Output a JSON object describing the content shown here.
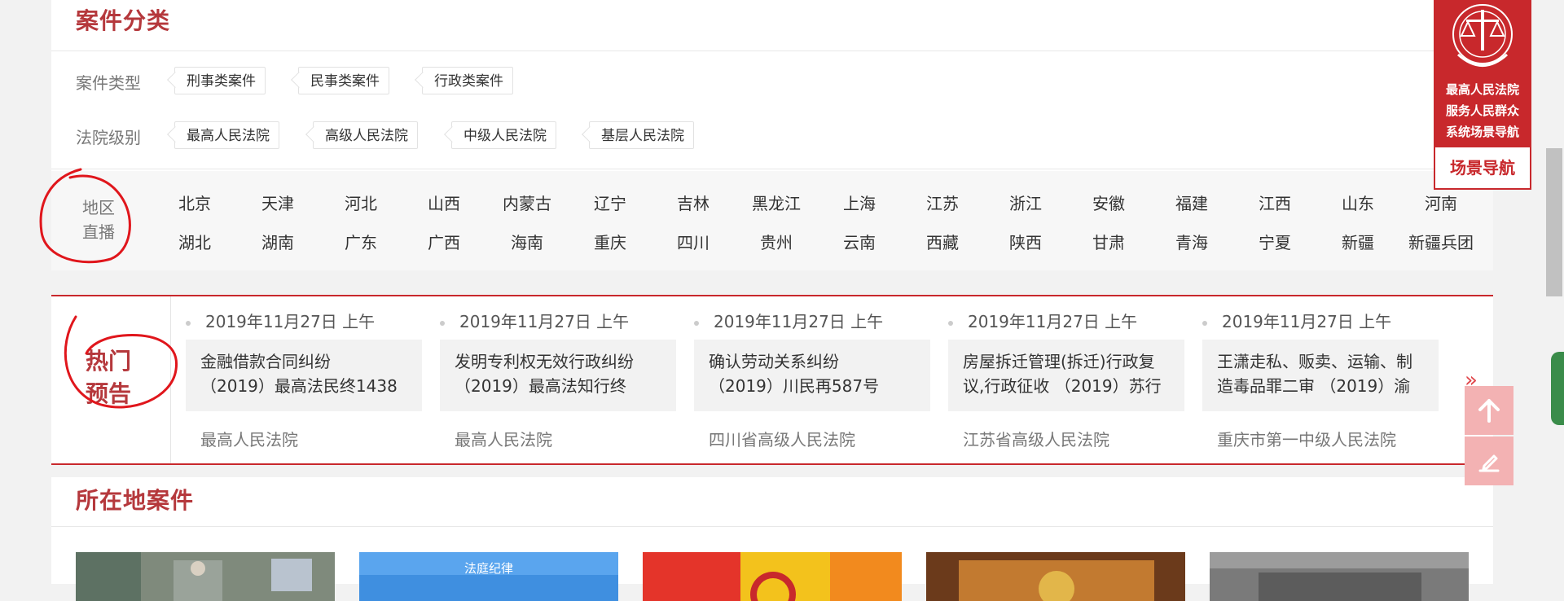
{
  "case_category": {
    "title": "案件分类",
    "case_type_label": "案件类型",
    "case_types": [
      "刑事类案件",
      "民事类案件",
      "行政类案件"
    ],
    "court_level_label": "法院级别",
    "court_levels": [
      "最高人民法院",
      "高级人民法院",
      "中级人民法院",
      "基层人民法院"
    ],
    "region_label_line1": "地区",
    "region_label_line2": "直播",
    "regions_row1": [
      "北京",
      "天津",
      "河北",
      "山西",
      "内蒙古",
      "辽宁",
      "吉林",
      "黑龙江",
      "上海",
      "江苏",
      "浙江",
      "安徽",
      "福建",
      "江西",
      "山东",
      "河南"
    ],
    "regions_row2": [
      "湖北",
      "湖南",
      "广东",
      "广西",
      "海南",
      "重庆",
      "四川",
      "贵州",
      "云南",
      "西藏",
      "陕西",
      "甘肃",
      "青海",
      "宁夏",
      "新疆",
      "新疆兵团"
    ]
  },
  "hot_preview": {
    "label_line1": "热门",
    "label_line2": "预告",
    "next_arrow": "»",
    "cards": [
      {
        "time": "2019年11月27日 上午",
        "line1": "金融借款合同纠纷",
        "line2": "（2019）最高法民终1438",
        "court": "最高人民法院"
      },
      {
        "time": "2019年11月27日 上午",
        "line1": "发明专利权无效行政纠纷",
        "line2": "（2019）最高法知行终",
        "court": "最高人民法院"
      },
      {
        "time": "2019年11月27日 上午",
        "line1": "确认劳动关系纠纷",
        "line2": "（2019）川民再587号",
        "court": "四川省高级人民法院"
      },
      {
        "time": "2019年11月27日 上午",
        "line1": "房屋拆迁管理(拆迁)行政复",
        "line2": "议,行政征收 （2019）苏行",
        "court": "江苏省高级人民法院"
      },
      {
        "time": "2019年11月27日 上午",
        "line1": "王潇走私、贩卖、运输、制",
        "line2": "造毒品罪二审 （2019）渝",
        "court": "重庆市第一中级人民法院"
      }
    ]
  },
  "location_cases": {
    "title": "所在地案件",
    "thumb2_caption": "法庭纪律"
  },
  "scene_nav": {
    "line1": "最高人民法院",
    "line2": "服务人民群众",
    "line3": "系统场景导航",
    "button": "场景导航"
  },
  "icons": {
    "top": "arrow-up-icon",
    "edit": "edit-icon",
    "emblem": "court-emblem-icon"
  },
  "colors": {
    "brand_red": "#c8282c",
    "title_red": "#b5383c",
    "float_pink": "#f3b2b3"
  }
}
